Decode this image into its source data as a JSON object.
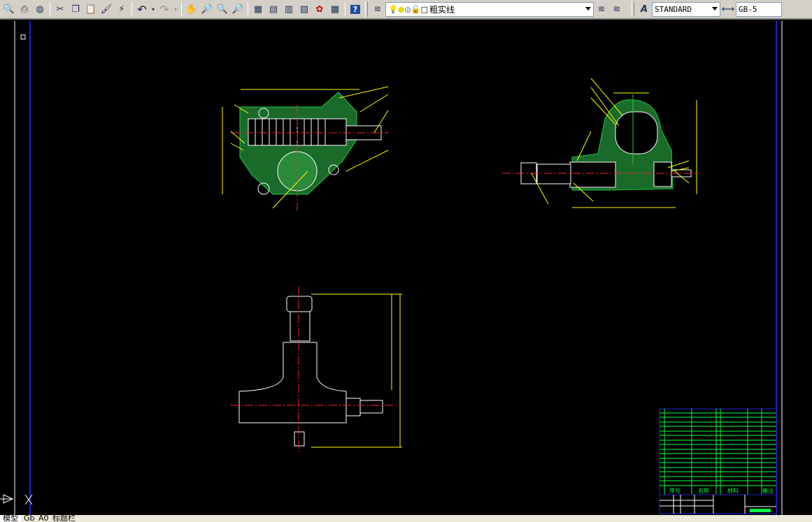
{
  "toolbar": {
    "icons": [
      "preview-icon",
      "publish-icon",
      "web-icon",
      "cut-icon",
      "copy-icon",
      "paste-icon",
      "match-properties-icon",
      "block-editor-icon",
      "undo-icon",
      "redo-icon",
      "pan-icon",
      "zoom-realtime-icon",
      "zoom-window-icon",
      "zoom-previous-icon",
      "properties-icon",
      "design-center-icon",
      "tool-palettes-icon",
      "sheet-set-icon",
      "markup-icon",
      "calculator-icon",
      "help-icon"
    ],
    "layer": {
      "current": "粗实线",
      "icons": [
        "layer-on-icon",
        "layer-freeze-icon",
        "layer-viewport-icon",
        "layer-lock-icon",
        "layer-color-icon"
      ]
    },
    "text_style": "STANDARD",
    "dim_style": "GB-5"
  },
  "tabs": {
    "model": "模型",
    "layout": "Gb_A0_标题栏"
  },
  "title_block": {
    "headers": [
      "序号",
      "名称",
      "材料",
      "备注"
    ]
  },
  "colors": {
    "background": "#000000",
    "outline": "#ffffff",
    "hatch": "#22cc44",
    "dimension": "#ffff00",
    "centerline": "#ff2020",
    "border": "#2020c0",
    "title_block": "#00ff40"
  }
}
